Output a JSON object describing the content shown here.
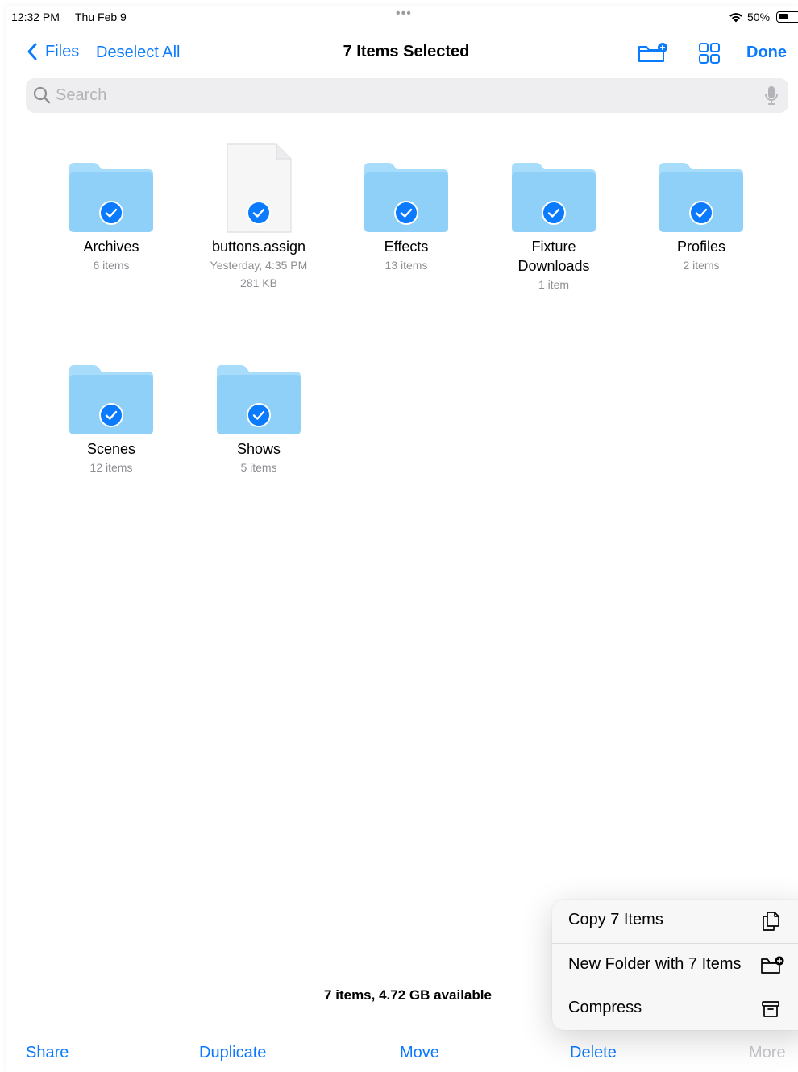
{
  "status_bar": {
    "time": "12:32 PM",
    "date": "Thu Feb 9",
    "battery_percent": "50%",
    "battery_level": 0.5,
    "multitask_dots": "•••"
  },
  "nav": {
    "back_label": "Files",
    "deselect_label": "Deselect All",
    "title": "7 Items Selected",
    "done_label": "Done"
  },
  "search": {
    "placeholder": "Search",
    "value": ""
  },
  "items": [
    {
      "name": "Archives",
      "meta": "6 items",
      "kind": "folder",
      "selected": true
    },
    {
      "name": "buttons.assign",
      "meta": "Yesterday, 4:35 PM",
      "meta2": "281 KB",
      "kind": "file",
      "selected": true
    },
    {
      "name": "Effects",
      "meta": "13 items",
      "kind": "folder",
      "selected": true
    },
    {
      "name": "Fixture Downloads",
      "meta": "1 item",
      "kind": "folder",
      "selected": true
    },
    {
      "name": "Profiles",
      "meta": "2 items",
      "kind": "folder",
      "selected": true
    },
    {
      "name": "Scenes",
      "meta": "12 items",
      "kind": "folder",
      "selected": true
    },
    {
      "name": "Shows",
      "meta": "5 items",
      "kind": "folder",
      "selected": true
    }
  ],
  "footer": {
    "info": "7 items, 4.72 GB available"
  },
  "toolbar": {
    "share": "Share",
    "duplicate": "Duplicate",
    "move": "Move",
    "delete": "Delete",
    "more": "More"
  },
  "menu": {
    "copy": "Copy 7 Items",
    "new_folder": "New Folder with 7 Items",
    "compress": "Compress"
  },
  "colors": {
    "accent": "#0a7aff",
    "folder": "#8fd0f8",
    "folder_tab": "#a8dcfb",
    "secondary_text": "#8e8e93"
  }
}
